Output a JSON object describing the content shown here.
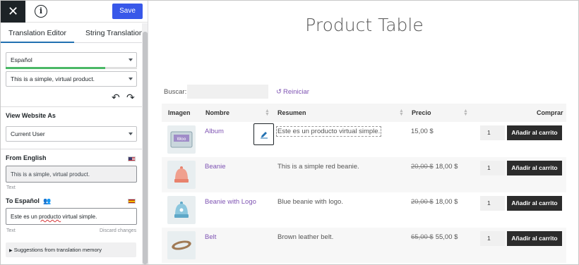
{
  "sidebar": {
    "close_icon": "close-icon",
    "info_icon": "info-icon",
    "save_label": "Save",
    "tabs": [
      {
        "label": "Translation Editor",
        "active": true
      },
      {
        "label": "String Translation",
        "active": false
      }
    ],
    "language_select": "Español",
    "translation_progress": 0.76,
    "string_select": "This is a simple, virtual product.",
    "view_as_label": "View Website As",
    "view_as_select": "Current User",
    "from_label": "From English",
    "from_text": "This is a simple, virtual product.",
    "from_type": "Text",
    "to_label": "To Español",
    "to_text_before": "Este es un ",
    "to_text_misspelled": "producto",
    "to_text_after": " virtual simple.",
    "to_type": "Text",
    "discard_label": "Discard changes",
    "tm_label": "Suggestions from translation memory"
  },
  "main": {
    "title": "Product Table",
    "search_label": "Buscar:",
    "reset_label": "Reiniciar",
    "columns": [
      "Imagen",
      "Nombre",
      "Resumen",
      "Precio",
      "Comprar"
    ],
    "rows": [
      {
        "name": "Album",
        "summary": "Este es un producto virtual simple.",
        "old_price": "",
        "price": "15,00 $",
        "qty": "1",
        "button": "Añadir al carrito"
      },
      {
        "name": "Beanie",
        "summary": "This is a simple red beanie.",
        "old_price": "20,00 $",
        "price": "18,00 $",
        "qty": "1",
        "button": "Añadir al carrito"
      },
      {
        "name": "Beanie with Logo",
        "summary": "Blue beanie with logo.",
        "old_price": "20,00 $",
        "price": "18,00 $",
        "qty": "1",
        "button": "Añadir al carrito"
      },
      {
        "name": "Belt",
        "summary": "Brown leather belt.",
        "old_price": "65,00 $",
        "price": "55,00 $",
        "qty": "1",
        "button": "Añadir al carrito"
      }
    ]
  },
  "colors": {
    "accent": "#3858e9",
    "link": "#7f54b3",
    "progress": "#4ab866",
    "cart_button": "#2c2c2c"
  }
}
